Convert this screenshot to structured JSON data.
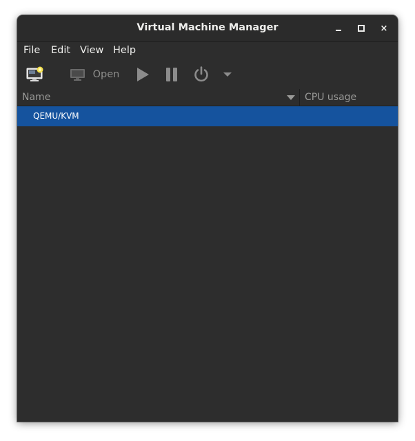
{
  "window": {
    "title": "Virtual Machine Manager",
    "controls": {
      "minimize": "minimize",
      "maximize": "maximize",
      "close": "×"
    }
  },
  "menubar": {
    "items": [
      {
        "label": "File"
      },
      {
        "label": "Edit"
      },
      {
        "label": "View"
      },
      {
        "label": "Help"
      }
    ]
  },
  "toolbar": {
    "new_vm_icon": "new-vm-monitor-icon",
    "open_label": "Open",
    "open_icon": "monitor-icon",
    "run_icon": "play-icon",
    "pause_icon": "pause-icon",
    "shutdown_icon": "power-icon",
    "dropdown_icon": "chevron-down-icon"
  },
  "columns": {
    "name": "Name",
    "cpu": "CPU usage"
  },
  "connections": [
    {
      "name": "QEMU/KVM",
      "selected": true
    }
  ],
  "colors": {
    "window_bg": "#2d2d2d",
    "selection": "#15539e",
    "text": "#eeeeec",
    "disabled_text": "#8e8e8c"
  }
}
